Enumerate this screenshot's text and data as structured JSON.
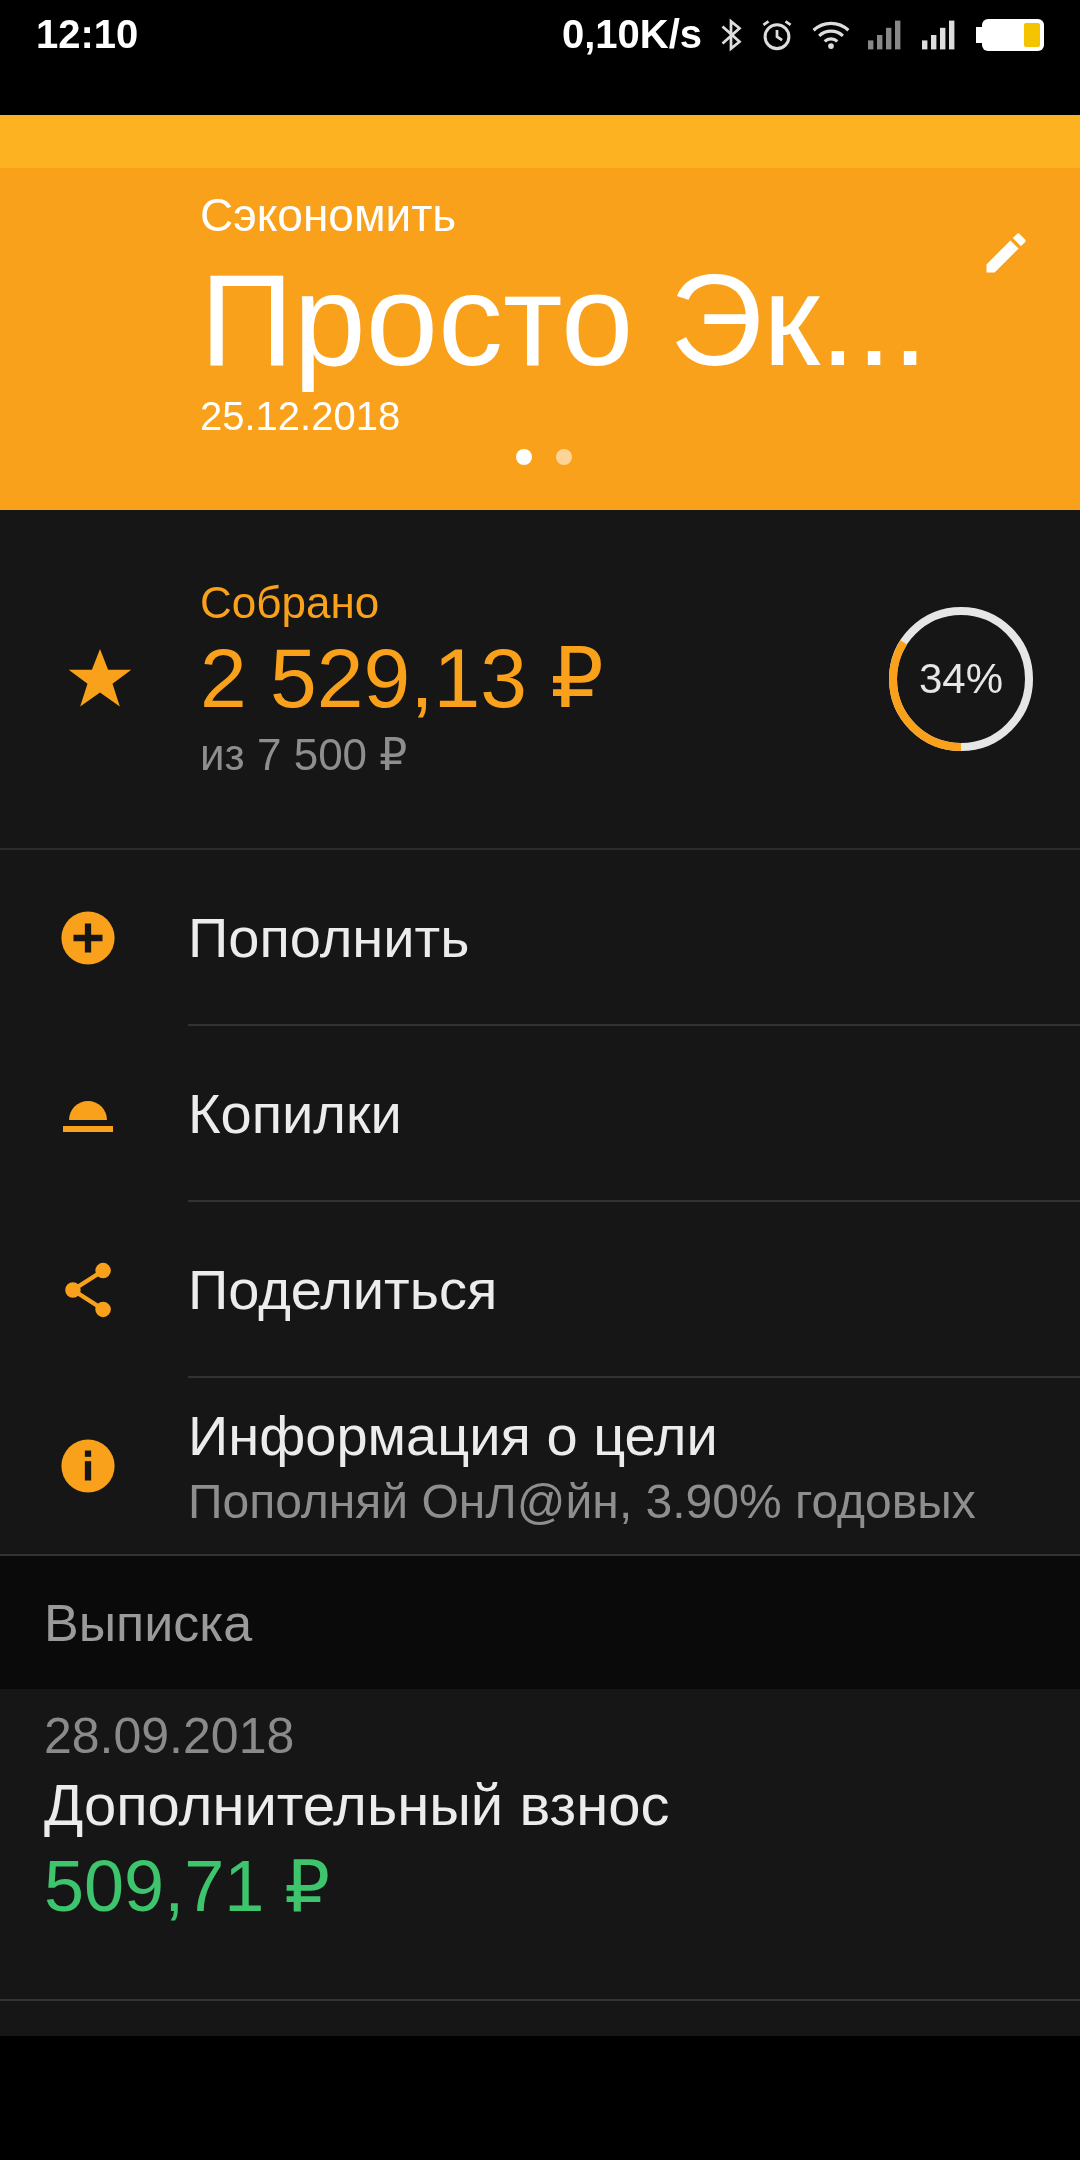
{
  "status_bar": {
    "time": "12:10",
    "speed": "0,10K/s"
  },
  "goal": {
    "category": "Сэкономить",
    "title": "Просто Эк...",
    "date": "25.12.2018",
    "pages": [
      {
        "selected": true
      },
      {
        "selected": false
      }
    ]
  },
  "summary": {
    "label": "Собрано",
    "amount": "2 529,13 ₽",
    "target": "из 7 500 ₽",
    "percent": "34%",
    "level": 0.34
  },
  "actions": [
    {
      "kind": "add",
      "label": "Пополнить"
    },
    {
      "kind": "piggy",
      "label": "Копилки"
    },
    {
      "kind": "share",
      "label": "Поделиться"
    },
    {
      "kind": "info",
      "label": "Информация о цели",
      "subtitle": "Пополняй ОнЛ@йн, 3.90% годовых"
    }
  ],
  "statement": {
    "title": "Выписка",
    "items": [
      {
        "date": "28.09.2018",
        "description": "Дополнительный взнос",
        "amount": "509,71 ₽"
      }
    ]
  }
}
